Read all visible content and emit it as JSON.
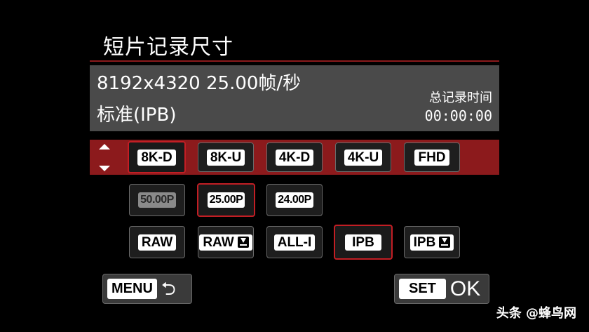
{
  "title": "短片记录尺寸",
  "info": {
    "line1": "8192x4320 25.00帧/秒",
    "line2": "标准(IPB)",
    "total_label": "总记录时间",
    "total_time": "00:00:00"
  },
  "resolution_options": [
    {
      "label": "8K-D",
      "selected": true
    },
    {
      "label": "8K-U",
      "selected": false
    },
    {
      "label": "4K-D",
      "selected": false
    },
    {
      "label": "4K-U",
      "selected": false
    },
    {
      "label": "FHD",
      "selected": false
    }
  ],
  "framerate_options": [
    {
      "label": "50.00P",
      "selected": false,
      "disabled": true
    },
    {
      "label": "25.00P",
      "selected": true,
      "disabled": false
    },
    {
      "label": "24.00P",
      "selected": false,
      "disabled": false
    }
  ],
  "compression_options": [
    {
      "label": "RAW",
      "selected": false
    },
    {
      "label": "RAW",
      "selected": false,
      "icon": "download-icon"
    },
    {
      "label": "ALL-I",
      "selected": false
    },
    {
      "label": "IPB",
      "selected": true
    },
    {
      "label": "IPB",
      "selected": false,
      "icon": "download-icon"
    }
  ],
  "menu_button": {
    "label": "MENU",
    "icon": "return-icon"
  },
  "set_button": {
    "label": "SET",
    "ok": "OK"
  },
  "watermark": "头条 @蜂鸟网",
  "colors": {
    "accent": "#8c1a1c",
    "selected_border": "#c21e24",
    "panel": "#4a4a4a"
  }
}
